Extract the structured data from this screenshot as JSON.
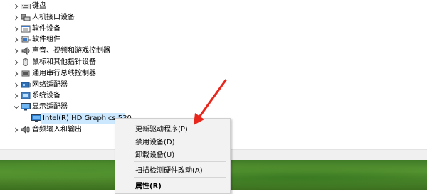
{
  "tree": {
    "items": [
      {
        "label": "键盘",
        "icon": "keyboard-icon",
        "expanded": false
      },
      {
        "label": "人机接口设备",
        "icon": "hid-icon",
        "expanded": false
      },
      {
        "label": "软件设备",
        "icon": "software-device-icon",
        "expanded": false
      },
      {
        "label": "软件组件",
        "icon": "software-component-icon",
        "expanded": false
      },
      {
        "label": "声音、视频和游戏控制器",
        "icon": "speaker-icon",
        "expanded": false
      },
      {
        "label": "鼠标和其他指针设备",
        "icon": "mouse-icon",
        "expanded": false
      },
      {
        "label": "通用串行总线控制器",
        "icon": "usb-icon",
        "expanded": false
      },
      {
        "label": "网络适配器",
        "icon": "network-adapter-icon",
        "expanded": false
      },
      {
        "label": "系统设备",
        "icon": "system-device-icon",
        "expanded": false
      },
      {
        "label": "显示适配器",
        "icon": "display-adapter-icon",
        "expanded": true
      },
      {
        "label": "Intel(R) HD Graphics 530",
        "icon": "display-adapter-icon",
        "child": true,
        "selected": true
      },
      {
        "label": "音频输入和输出",
        "icon": "audio-io-icon",
        "expanded": false
      }
    ]
  },
  "context_menu": {
    "items": [
      {
        "label": "更新驱动程序(P)"
      },
      {
        "label": "禁用设备(D)"
      },
      {
        "label": "卸载设备(U)"
      },
      {
        "label": "扫描检测硬件改动(A)"
      },
      {
        "label": "属性(R)",
        "bold": true
      }
    ]
  },
  "colors": {
    "annotation_arrow": "#e8261c",
    "selection": "#cce8ff",
    "menu_background": "#f2f2f2"
  }
}
